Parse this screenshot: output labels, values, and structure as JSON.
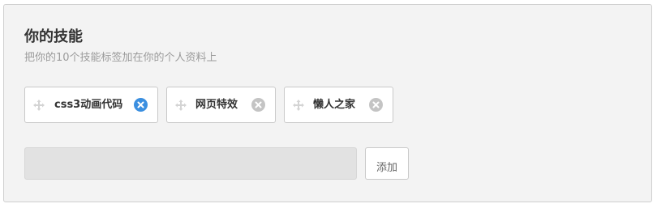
{
  "header": {
    "title": "你的技能",
    "subtitle": "把你的10个技能标签加在你的个人资料上"
  },
  "tags": [
    {
      "label": "css3动画代码",
      "remove_state": "active",
      "remove_icon": "close-circle-icon"
    },
    {
      "label": "网页特效",
      "remove_state": "default",
      "remove_icon": "close-circle-icon"
    },
    {
      "label": "懒人之家",
      "remove_state": "default",
      "remove_icon": "close-circle-icon"
    }
  ],
  "drag_icon": "drag-handle-icon",
  "form": {
    "input_value": "",
    "input_placeholder": "",
    "add_label": "添加"
  },
  "colors": {
    "panel_bg": "#f3f3f3",
    "remove_active": "#3b8fe0",
    "remove_default": "#c4c4c4",
    "input_bg": "#e2e2e2"
  }
}
